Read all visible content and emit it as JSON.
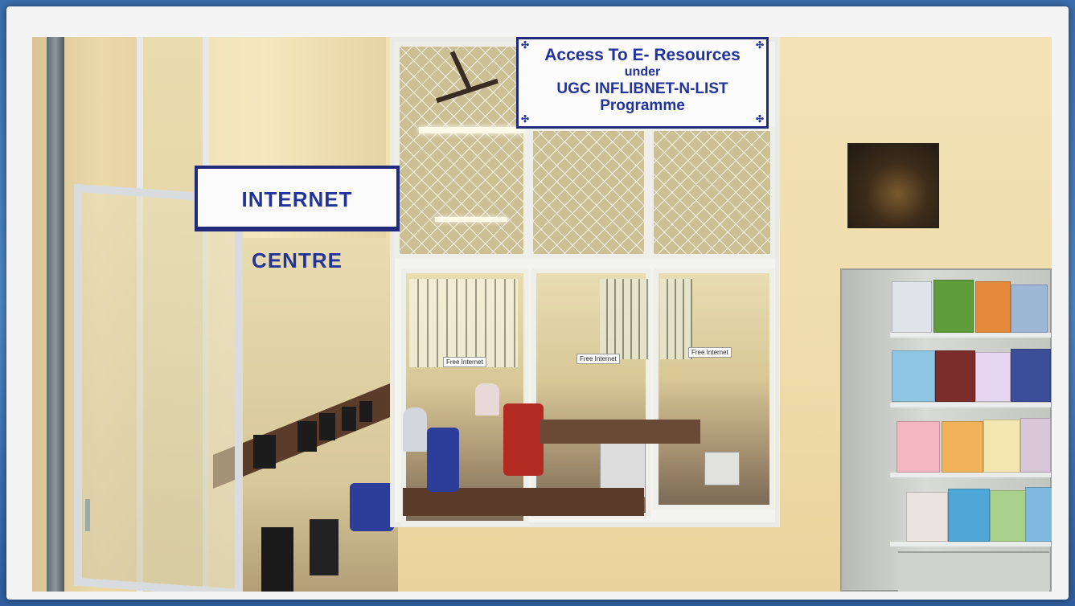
{
  "scene": {
    "signs": {
      "internet_centre": "INTERNET CENTRE",
      "access_line1": "Access To E- Resources",
      "access_line2": "under",
      "access_line3": "UGC INFLIBNET-N-LIST Programme"
    },
    "window_tags": [
      "Free Internet",
      "Free Internet",
      "Free Internet"
    ]
  },
  "colors": {
    "sign_text": "#22339a",
    "sign_border": "#1f2a7a",
    "wall": "#efdcaa",
    "outer_frame_bg": "#3b6fb0"
  }
}
